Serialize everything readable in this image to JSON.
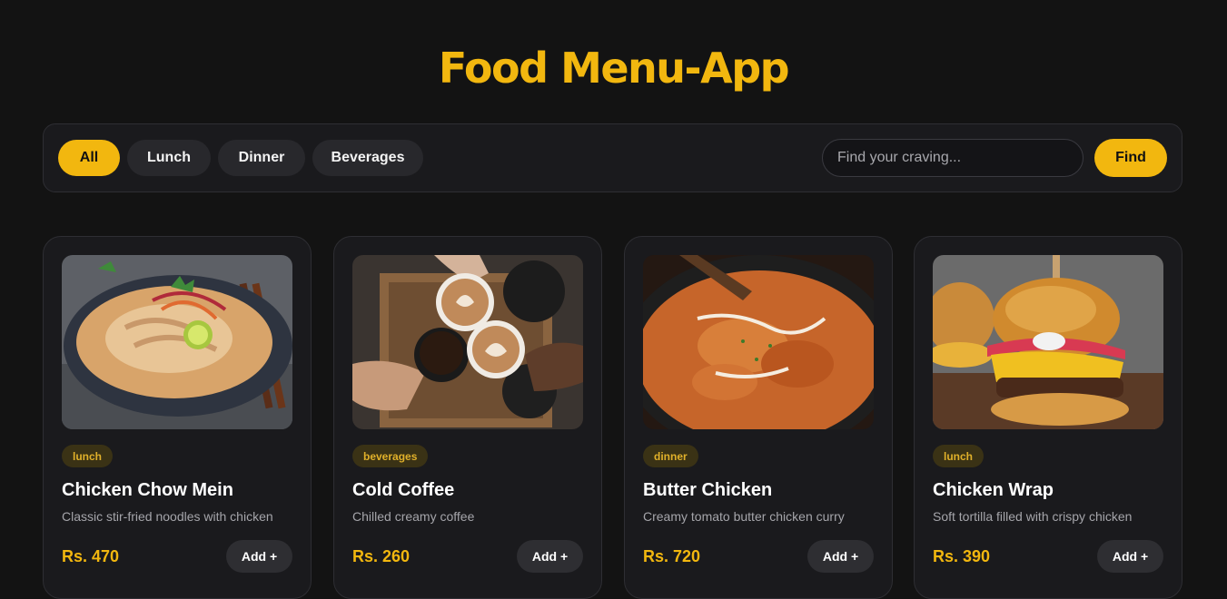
{
  "app": {
    "title": "Food Menu-App"
  },
  "filters": [
    {
      "label": "All",
      "active": true
    },
    {
      "label": "Lunch",
      "active": false
    },
    {
      "label": "Dinner",
      "active": false
    },
    {
      "label": "Beverages",
      "active": false
    }
  ],
  "search": {
    "placeholder": "Find your craving...",
    "value": "",
    "button_label": "Find"
  },
  "colors": {
    "accent": "#f2b70f",
    "background": "#131313",
    "card": "#1a1a1d"
  },
  "items": [
    {
      "tag": "lunch",
      "name": "Chicken Chow Mein",
      "description": "Classic stir-fried noodles with chicken",
      "price": "Rs. 470",
      "add_label": "Add +",
      "image": "noodle-bowl-photo"
    },
    {
      "tag": "beverages",
      "name": "Cold Coffee",
      "description": "Chilled creamy coffee",
      "price": "Rs. 260",
      "add_label": "Add +",
      "image": "coffee-cheers-photo"
    },
    {
      "tag": "dinner",
      "name": "Butter Chicken",
      "description": "Creamy tomato butter chicken curry",
      "price": "Rs. 720",
      "add_label": "Add +",
      "image": "curry-pan-photo"
    },
    {
      "tag": "lunch",
      "name": "Chicken Wrap",
      "description": "Soft tortilla filled with crispy chicken",
      "price": "Rs. 390",
      "add_label": "Add +",
      "image": "burger-photo"
    }
  ]
}
